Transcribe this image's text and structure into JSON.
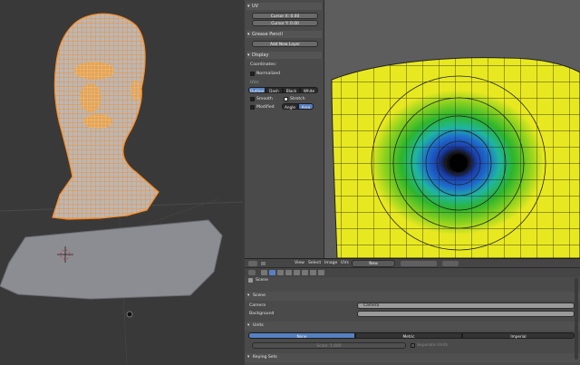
{
  "uv_panel": {
    "uv_header": "UV",
    "cursor_x": "Cursor X: 0.00",
    "cursor_y": "Cursor Y: 0.00",
    "grease_header": "Grease Pencil",
    "add_layer": "Add New Layer",
    "display_header": "Display",
    "coordinates_label": "Coordinates:",
    "normalized_label": "Normalized",
    "uvs_label": "UVs:",
    "uv_styles": [
      "Outline",
      "Dash",
      "Black",
      "White"
    ],
    "uv_style_selected": "Outline",
    "smooth_label": "Smooth",
    "stretch_label": "Stretch",
    "modified_label": "Modified",
    "stretch_modes": [
      "Angle",
      "Area"
    ],
    "stretch_mode_selected": "Area"
  },
  "uv_header_bar": {
    "menus": [
      "View",
      "Select",
      "Image",
      "UVs"
    ],
    "image_label": "New"
  },
  "properties": {
    "breadcrumb": "Scene",
    "scene_section": "Scene",
    "camera_label": "Camera",
    "camera_value": "Camera",
    "background_label": "Background",
    "units_section": "Units",
    "unit_systems": [
      "None",
      "Metric",
      "Imperial"
    ],
    "unit_selected": "None",
    "scale_field": "Scale: 1.000",
    "separate_units": "Separate Units",
    "keying_section": "Keying Sets"
  },
  "colors": {
    "selection_orange": "#ff8a1f",
    "accent_blue": "#5680c2",
    "uv_yellow": "#e8e820",
    "uv_green": "#2db52d",
    "uv_blue": "#1a3fb0"
  }
}
